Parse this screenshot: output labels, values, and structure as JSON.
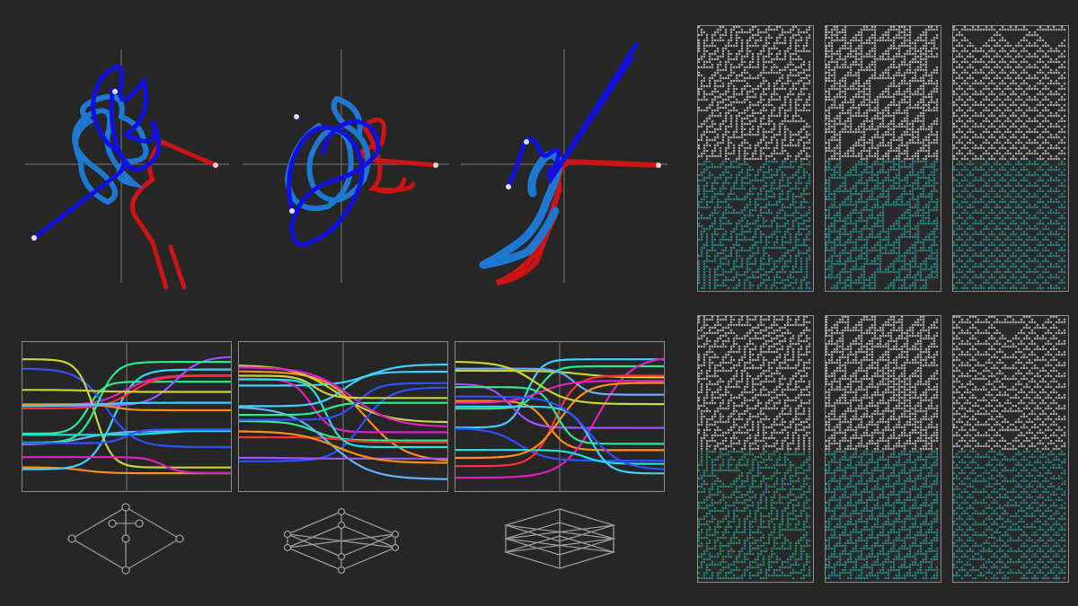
{
  "figure": {
    "background": "#262626",
    "sections": {
      "trajectory_plots": {
        "count": 3,
        "colors": {
          "early": "#1010e0",
          "mid": "#1e78d2",
          "late": "#cc1414"
        }
      },
      "line_plots": {
        "count": 3,
        "palette": [
          "#ff8c1a",
          "#3fd0ff",
          "#2ee88a",
          "#e020c0",
          "#3050ff",
          "#c8d23c",
          "#ff3030",
          "#60b0ff",
          "#a050ff",
          "#20e0e0"
        ]
      },
      "graph_icons": {
        "count": 3,
        "stroke": "#9a9a9a"
      },
      "cellular_automata": {
        "count": 6,
        "cell_color": "#c8c8c8",
        "highlight": "#2ad8d8",
        "highlight_alt": "#30e070"
      }
    }
  }
}
